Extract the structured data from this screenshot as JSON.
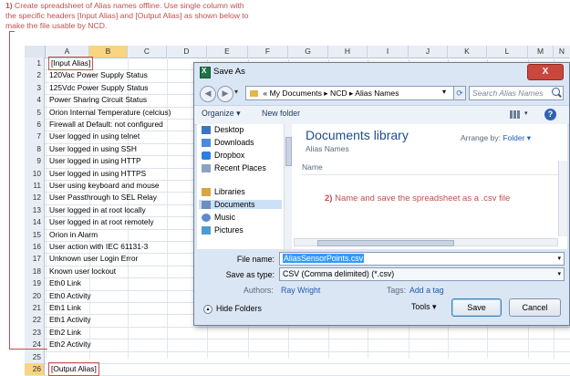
{
  "instructions": {
    "step1_num": "1)",
    "step1_text": "Create spreadsheet of Alias names offline.  Use single column with the specific headers [Input Alias] and [Output Alias] as shown below to make the file usable by NCD."
  },
  "spreadsheet": {
    "columns": [
      "A",
      "B",
      "C",
      "D",
      "E",
      "F",
      "G",
      "H",
      "I",
      "J",
      "K",
      "L",
      "M",
      "N"
    ],
    "rows": [
      {
        "num": "1",
        "value": "[Input Alias]"
      },
      {
        "num": "2",
        "value": "120Vac Power Supply Status"
      },
      {
        "num": "3",
        "value": "125Vdc Power Supply Status"
      },
      {
        "num": "4",
        "value": "Power Sharing Circuit Status"
      },
      {
        "num": "5",
        "value": "Orion Internal Temperature (celcius)"
      },
      {
        "num": "6",
        "value": "Firewall at Default: not configured"
      },
      {
        "num": "7",
        "value": "User logged in using telnet"
      },
      {
        "num": "8",
        "value": "User logged in using SSH"
      },
      {
        "num": "9",
        "value": "User logged in using HTTP"
      },
      {
        "num": "10",
        "value": "User logged in using HTTPS"
      },
      {
        "num": "11",
        "value": "User using keyboard and mouse"
      },
      {
        "num": "12",
        "value": "User Passthrough to SEL Relay"
      },
      {
        "num": "13",
        "value": "User logged in at root locally"
      },
      {
        "num": "14",
        "value": "User logged in at root remotely"
      },
      {
        "num": "15",
        "value": "Orion in Alarm"
      },
      {
        "num": "16",
        "value": "User action with IEC 61131-3"
      },
      {
        "num": "17",
        "value": "Unknown user Login Error"
      },
      {
        "num": "18",
        "value": "Known user lockout"
      },
      {
        "num": "19",
        "value": "Eth0 Link"
      },
      {
        "num": "20",
        "value": "Eth0 Activity"
      },
      {
        "num": "21",
        "value": "Eth1 Link"
      },
      {
        "num": "22",
        "value": "Eth1 Activity"
      },
      {
        "num": "23",
        "value": "Eth2 Link"
      },
      {
        "num": "24",
        "value": "Eth2 Activity"
      },
      {
        "num": "25",
        "value": ""
      },
      {
        "num": "26",
        "value": "[Output Alias]"
      }
    ]
  },
  "dialog": {
    "title": "Save As",
    "close": "X",
    "address": {
      "prefix": "«",
      "path1": "My Documents",
      "path2": "NCD",
      "path3": "Alias Names",
      "sep": "▸"
    },
    "search_placeholder": "Search Alias Names",
    "toolbar": {
      "organize": "Organize ▾",
      "new_folder": "New folder"
    },
    "nav_items": [
      {
        "icon": "desktop-icon",
        "label": "Desktop"
      },
      {
        "icon": "downloads-icon",
        "label": "Downloads"
      },
      {
        "icon": "dropbox-icon",
        "label": "Dropbox"
      },
      {
        "icon": "recent-places-icon",
        "label": "Recent Places"
      },
      {
        "icon": "libraries-icon",
        "label": "Libraries"
      },
      {
        "icon": "documents-icon",
        "label": "Documents"
      },
      {
        "icon": "music-icon",
        "label": "Music"
      },
      {
        "icon": "pictures-icon",
        "label": "Pictures"
      }
    ],
    "library_title": "Documents library",
    "library_sub": "Alias Names",
    "arrange_label": "Arrange by:",
    "arrange_value": "Folder ▾",
    "name_header": "Name",
    "step2_num": "2)",
    "step2_text": "Name and save the spreadsheet as a .csv file",
    "file_name_label": "File name:",
    "file_name_value": "AliasSensorPoints.csv",
    "save_type_label": "Save as type:",
    "save_type_value": "CSV (Comma delimited) (*.csv)",
    "authors_label": "Authors:",
    "authors_value": "Ray Wright",
    "tags_label": "Tags:",
    "tags_value": "Add a tag",
    "hide_folders": "Hide Folders",
    "tools": "Tools ▾",
    "save": "Save",
    "cancel": "Cancel"
  },
  "colors": {
    "annotation": "#c0504d",
    "selected_header": "#f8d57e",
    "link": "#1e5bb5"
  }
}
